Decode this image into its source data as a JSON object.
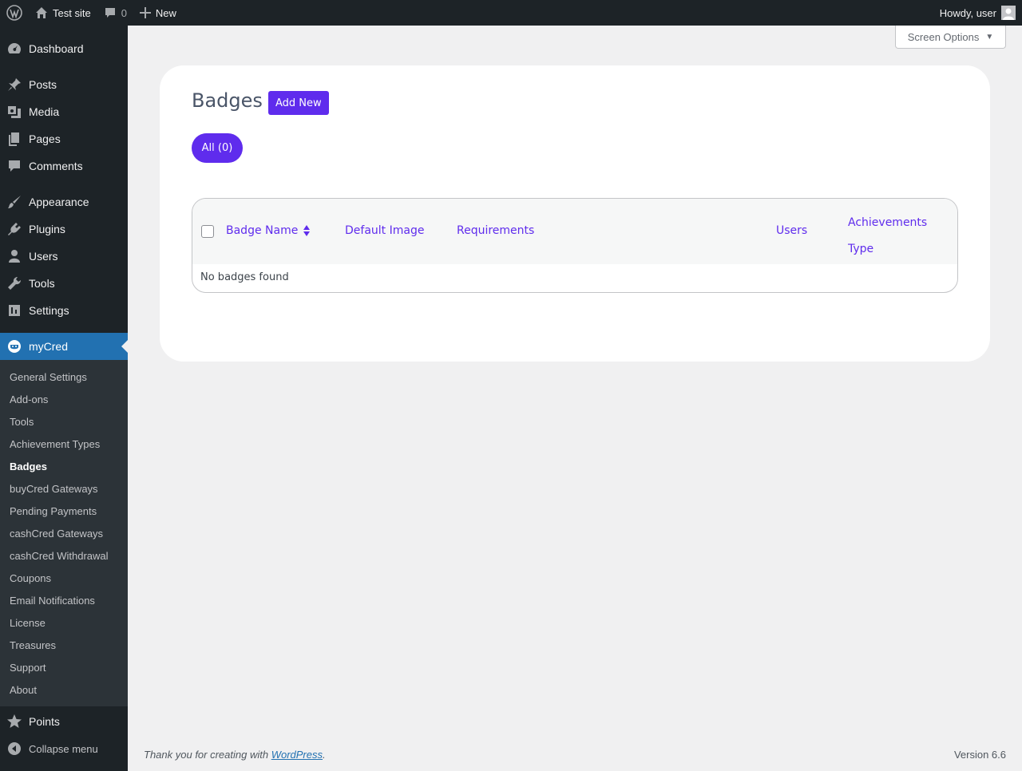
{
  "adminbar": {
    "site_name": "Test site",
    "comments_count": "0",
    "new_label": "New",
    "howdy": "Howdy, user"
  },
  "sidebar": {
    "menu": [
      {
        "label": "Dashboard",
        "icon": "dashboard-icon"
      },
      {
        "label": "Posts",
        "icon": "pin-icon"
      },
      {
        "label": "Media",
        "icon": "media-icon"
      },
      {
        "label": "Pages",
        "icon": "pages-icon"
      },
      {
        "label": "Comments",
        "icon": "comment-icon"
      },
      {
        "label": "Appearance",
        "icon": "brush-icon"
      },
      {
        "label": "Plugins",
        "icon": "plugin-icon"
      },
      {
        "label": "Users",
        "icon": "user-icon"
      },
      {
        "label": "Tools",
        "icon": "wrench-icon"
      },
      {
        "label": "Settings",
        "icon": "settings-icon"
      },
      {
        "label": "myCred",
        "icon": "mycred-icon"
      }
    ],
    "submenu": [
      "General Settings",
      "Add-ons",
      "Tools",
      "Achievement Types",
      "Badges",
      "buyCred Gateways",
      "Pending Payments",
      "cashCred Gateways",
      "cashCred Withdrawal",
      "Coupons",
      "Email Notifications",
      "License",
      "Treasures",
      "Support",
      "About"
    ],
    "points_label": "Points",
    "collapse_label": "Collapse menu"
  },
  "screen_options": "Screen Options",
  "main": {
    "title": "Badges",
    "add_new": "Add New",
    "filter_all": "All (0)",
    "columns": {
      "name": "Badge Name",
      "image": "Default Image",
      "requirements": "Requirements",
      "users": "Users",
      "type": "Achievements Type"
    },
    "empty_message": "No badges found"
  },
  "footer": {
    "thanks_prefix": "Thank you for creating with ",
    "wordpress_link": "WordPress",
    "thanks_suffix": ".",
    "version": "Version 6.6"
  },
  "colors": {
    "accent": "#5f2ced",
    "adminbar": "#1d2327",
    "active_menu": "#2271b1"
  }
}
